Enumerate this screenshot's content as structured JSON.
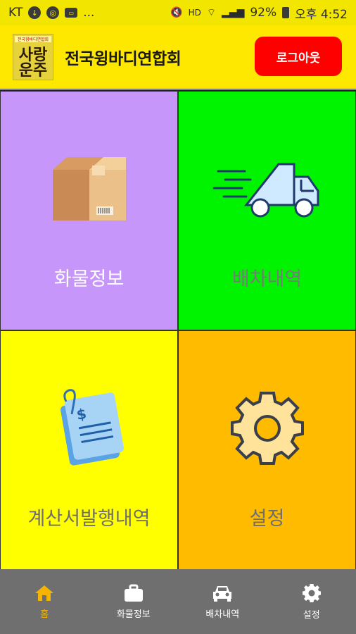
{
  "status_bar": {
    "carrier": "KT",
    "more": "...",
    "battery": "92%",
    "time": "오후 4:52"
  },
  "header": {
    "logo_top_text": "전국윙바디연합회",
    "logo_text": "사랑운주",
    "org_name": "전국윙바디연합회",
    "logout_label": "로그아웃"
  },
  "tiles": [
    {
      "label": "화물정보",
      "icon": "box-icon",
      "color": "#c696fa"
    },
    {
      "label": "배차내역",
      "icon": "truck-icon",
      "color": "#00f400"
    },
    {
      "label": "계산서발행내역",
      "icon": "invoice-icon",
      "color": "#ffff00"
    },
    {
      "label": "설정",
      "icon": "gear-icon",
      "color": "#ffbb00"
    }
  ],
  "bottom_nav": [
    {
      "label": "홈",
      "icon": "home-icon",
      "active": true
    },
    {
      "label": "화물정보",
      "icon": "briefcase-icon",
      "active": false
    },
    {
      "label": "배차내역",
      "icon": "car-icon",
      "active": false
    },
    {
      "label": "설정",
      "icon": "gear-icon",
      "active": false
    }
  ],
  "colors": {
    "status_bar": "#f2e600",
    "header": "#ffe800",
    "logout": "#ff0000",
    "nav_bg": "#6f6f6f",
    "nav_active": "#f5b400"
  }
}
